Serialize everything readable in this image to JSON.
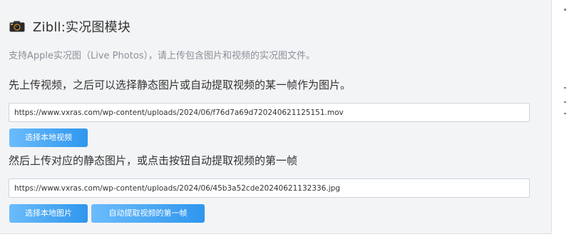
{
  "module": {
    "title": "Zibll:实况图模块",
    "icon": "camera-icon",
    "description": "支持Apple实况图（Live Photos），请上传包含图片和视频的实况图文件。"
  },
  "video_step": {
    "instruction": "先上传视频，之后可以选择静态图片或自动提取视频的某一帧作为图片。",
    "url_value": "https://www.vxras.com/wp-content/uploads/2024/06/f76d7a69d720240621125151.mov",
    "button_label": "选择本地视频"
  },
  "image_step": {
    "instruction": "然后上传对应的静态图片，或点击按钮自动提取视频的第一帧",
    "url_value": "https://www.vxras.com/wp-content/uploads/2024/06/45b3a52cde20240621132336.jpg",
    "select_button_label": "选择本地图片",
    "extract_button_label": "自动提取视频的第一帧"
  },
  "colors": {
    "panel_bg": "#f3f4f6",
    "button_gradient_start": "#6bbcfb",
    "button_gradient_end": "#2f96ee"
  }
}
